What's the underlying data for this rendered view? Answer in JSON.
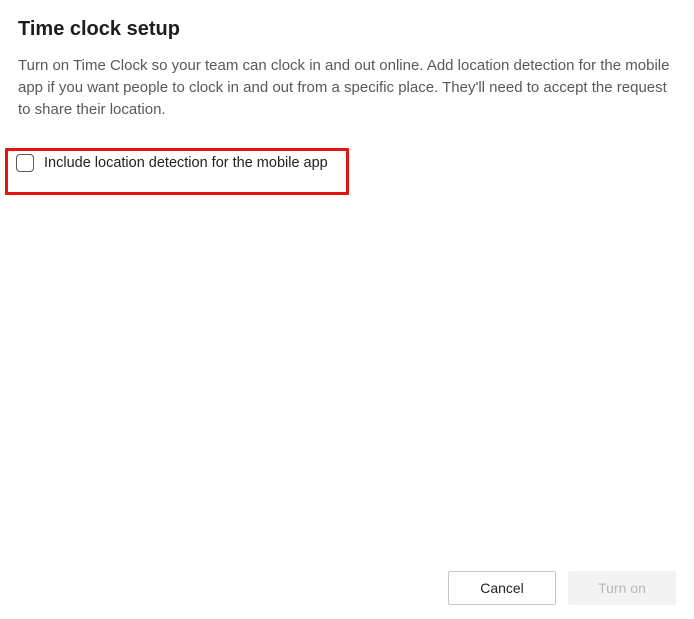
{
  "dialog": {
    "title": "Time clock setup",
    "description": "Turn on Time Clock so your team can clock in and out online. Add location detection for the mobile app if you want people to clock in and out from a specific place. They'll need to accept the request to share their location.",
    "checkbox_label": "Include location detection for the mobile app",
    "checkbox_checked": false
  },
  "footer": {
    "cancel_label": "Cancel",
    "confirm_label": "Turn on",
    "confirm_enabled": false
  },
  "highlight": {
    "color": "#e8130e"
  }
}
